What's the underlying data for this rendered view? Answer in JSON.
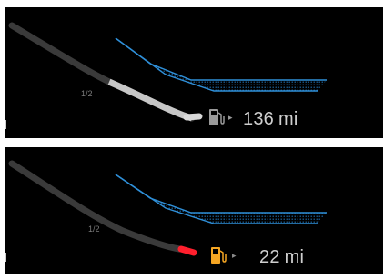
{
  "top_gauge": {
    "half_label": "1/2",
    "range_value": "136",
    "range_unit": "mi",
    "fuel_level_fraction": 0.55,
    "icon": "fuel-pump-icon",
    "fill_color": "#c6c6c6",
    "icon_color": "#9a9a9a"
  },
  "bottom_gauge": {
    "half_label": "1/2",
    "range_value": "22",
    "range_unit": "mi",
    "fuel_level_fraction": 0.08,
    "icon": "fuel-pump-icon",
    "fill_color": "#ff1f2d",
    "icon_color": "#f5a623"
  },
  "colors": {
    "background": "#000000",
    "gauge_track": "#3a3a3a",
    "road_edge": "#2f8fd8",
    "road_dots": "#1f6fb0"
  }
}
